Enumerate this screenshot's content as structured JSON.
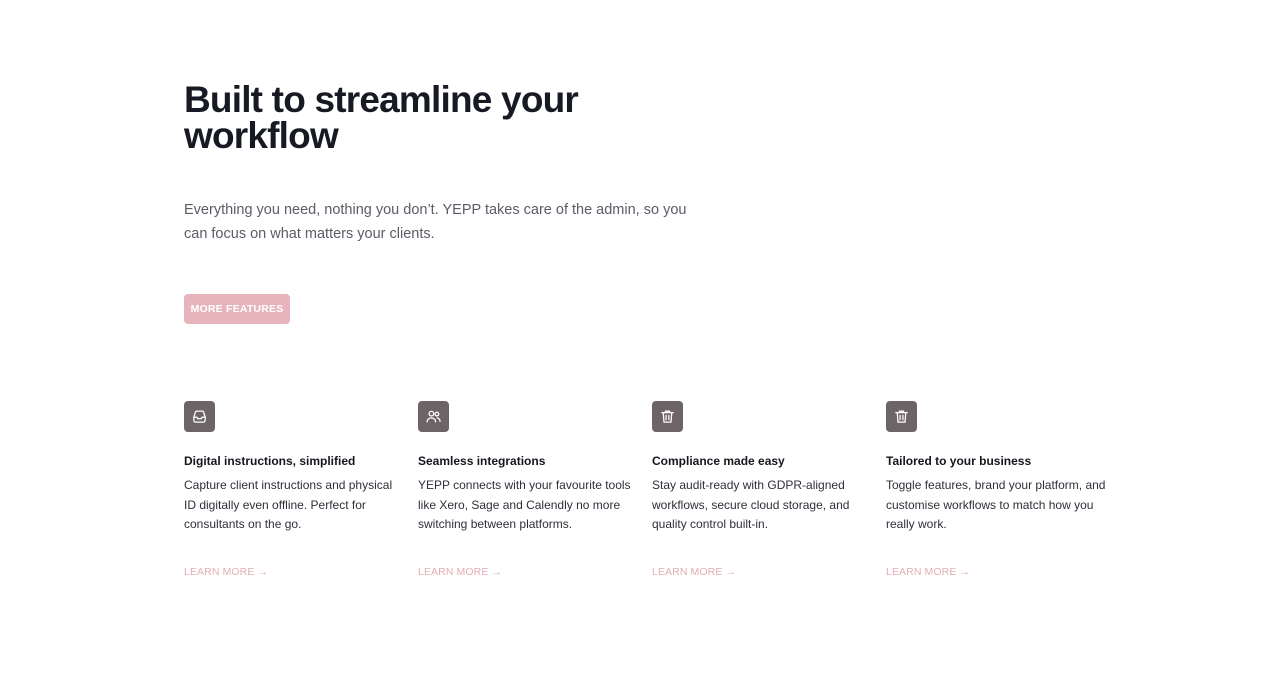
{
  "hero": {
    "title": "Built to streamline your workflow",
    "subtitle": "Everything you need, nothing you don’t. YEPP takes care of the admin, so you can focus on what matters your clients.",
    "cta_label": "MORE FEATURES"
  },
  "features": [
    {
      "icon": "inbox-icon",
      "title": "Digital instructions, simplified",
      "description": "Capture client instructions and physical ID digitally even offline. Perfect for consultants on the go.",
      "link_label": "LEARN MORE →"
    },
    {
      "icon": "users-icon",
      "title": "Seamless integrations",
      "description": "YEPP connects with your favourite tools like Xero, Sage and Calendly no more switching between platforms.",
      "link_label": "LEARN MORE →"
    },
    {
      "icon": "trash-icon",
      "title": "Compliance made easy",
      "description": "Stay audit-ready with GDPR-aligned workflows, secure cloud storage, and quality control built-in.",
      "link_label": "LEARN MORE →"
    },
    {
      "icon": "trash-icon",
      "title": "Tailored to your business",
      "description": "Toggle features, brand your platform, and customise workflows to match how you really work.",
      "link_label": "LEARN MORE →"
    }
  ],
  "colors": {
    "accent": "#e8b4bb",
    "link": "#e3aeb6",
    "icon_bg": "#6d6467",
    "heading": "#171a23",
    "body_text": "#5a5d66"
  }
}
